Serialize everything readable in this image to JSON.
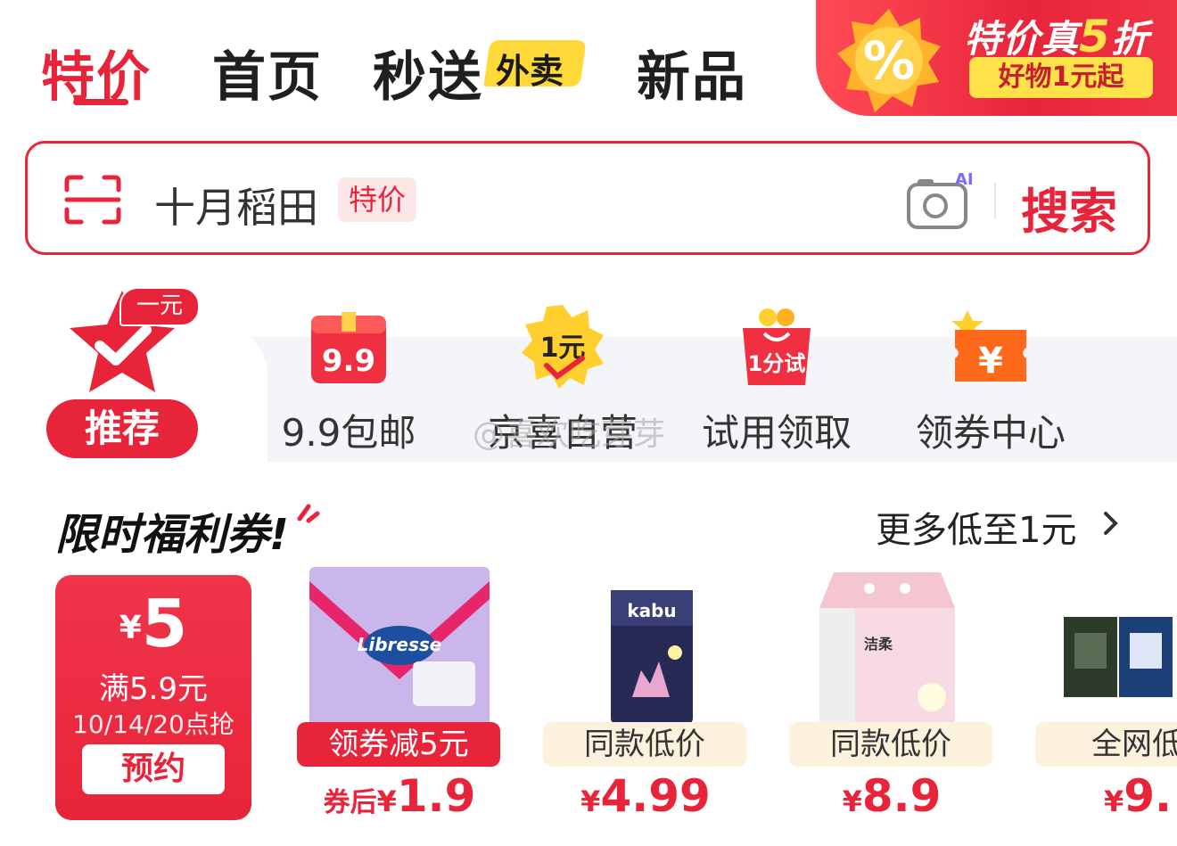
{
  "tabs": [
    {
      "label": "特价",
      "active": true
    },
    {
      "label": "首页"
    },
    {
      "label": "秒送",
      "badge": "外卖"
    },
    {
      "label": "新品"
    }
  ],
  "promo": {
    "title_pre": "特价真",
    "title_num": "5",
    "title_post": "折",
    "subtitle": "好物1元起"
  },
  "search": {
    "query": "十月稻田",
    "tag": "特价",
    "ai_label": "AI",
    "button": "搜索"
  },
  "categories": {
    "recommend": {
      "badge": "一元",
      "label": "推荐"
    },
    "items": [
      {
        "icon": "gift-box-99-icon",
        "icon_text": "9.9",
        "label": "9.9包邮"
      },
      {
        "icon": "one-yuan-burst-icon",
        "icon_text": "1元",
        "label": "京喜自营"
      },
      {
        "icon": "shopping-bag-trial-icon",
        "icon_text": "1分试",
        "label": "试用领取"
      },
      {
        "icon": "coupon-yen-icon",
        "icon_text": "¥",
        "label": "领券中心"
      }
    ],
    "watermark": "@喜欢吃芽芽"
  },
  "section": {
    "title": "限时福利券!",
    "more": "更多低至1元"
  },
  "coupon": {
    "currency": "¥",
    "amount": "5",
    "condition": "满5.9元",
    "time": "10/14/20点抢",
    "button": "预约"
  },
  "products": [
    {
      "name": "Libresse",
      "tag": "领券减5元",
      "tag_style": "red",
      "price_prefix": "券后",
      "currency": "¥",
      "price": "1.9"
    },
    {
      "name": "kabu",
      "tag": "同款低价",
      "tag_style": "beige",
      "price_prefix": "",
      "currency": "¥",
      "price": "4.99"
    },
    {
      "name": "洁柔",
      "tag": "同款低价",
      "tag_style": "beige",
      "price_prefix": "",
      "currency": "¥",
      "price": "8.9"
    },
    {
      "name": "",
      "tag": "全网低",
      "tag_style": "beige",
      "price_prefix": "",
      "currency": "¥",
      "price": "9."
    }
  ],
  "colors": {
    "accent": "#e8243a",
    "yellow": "#ffd83a",
    "beige": "#fbf1dc"
  }
}
